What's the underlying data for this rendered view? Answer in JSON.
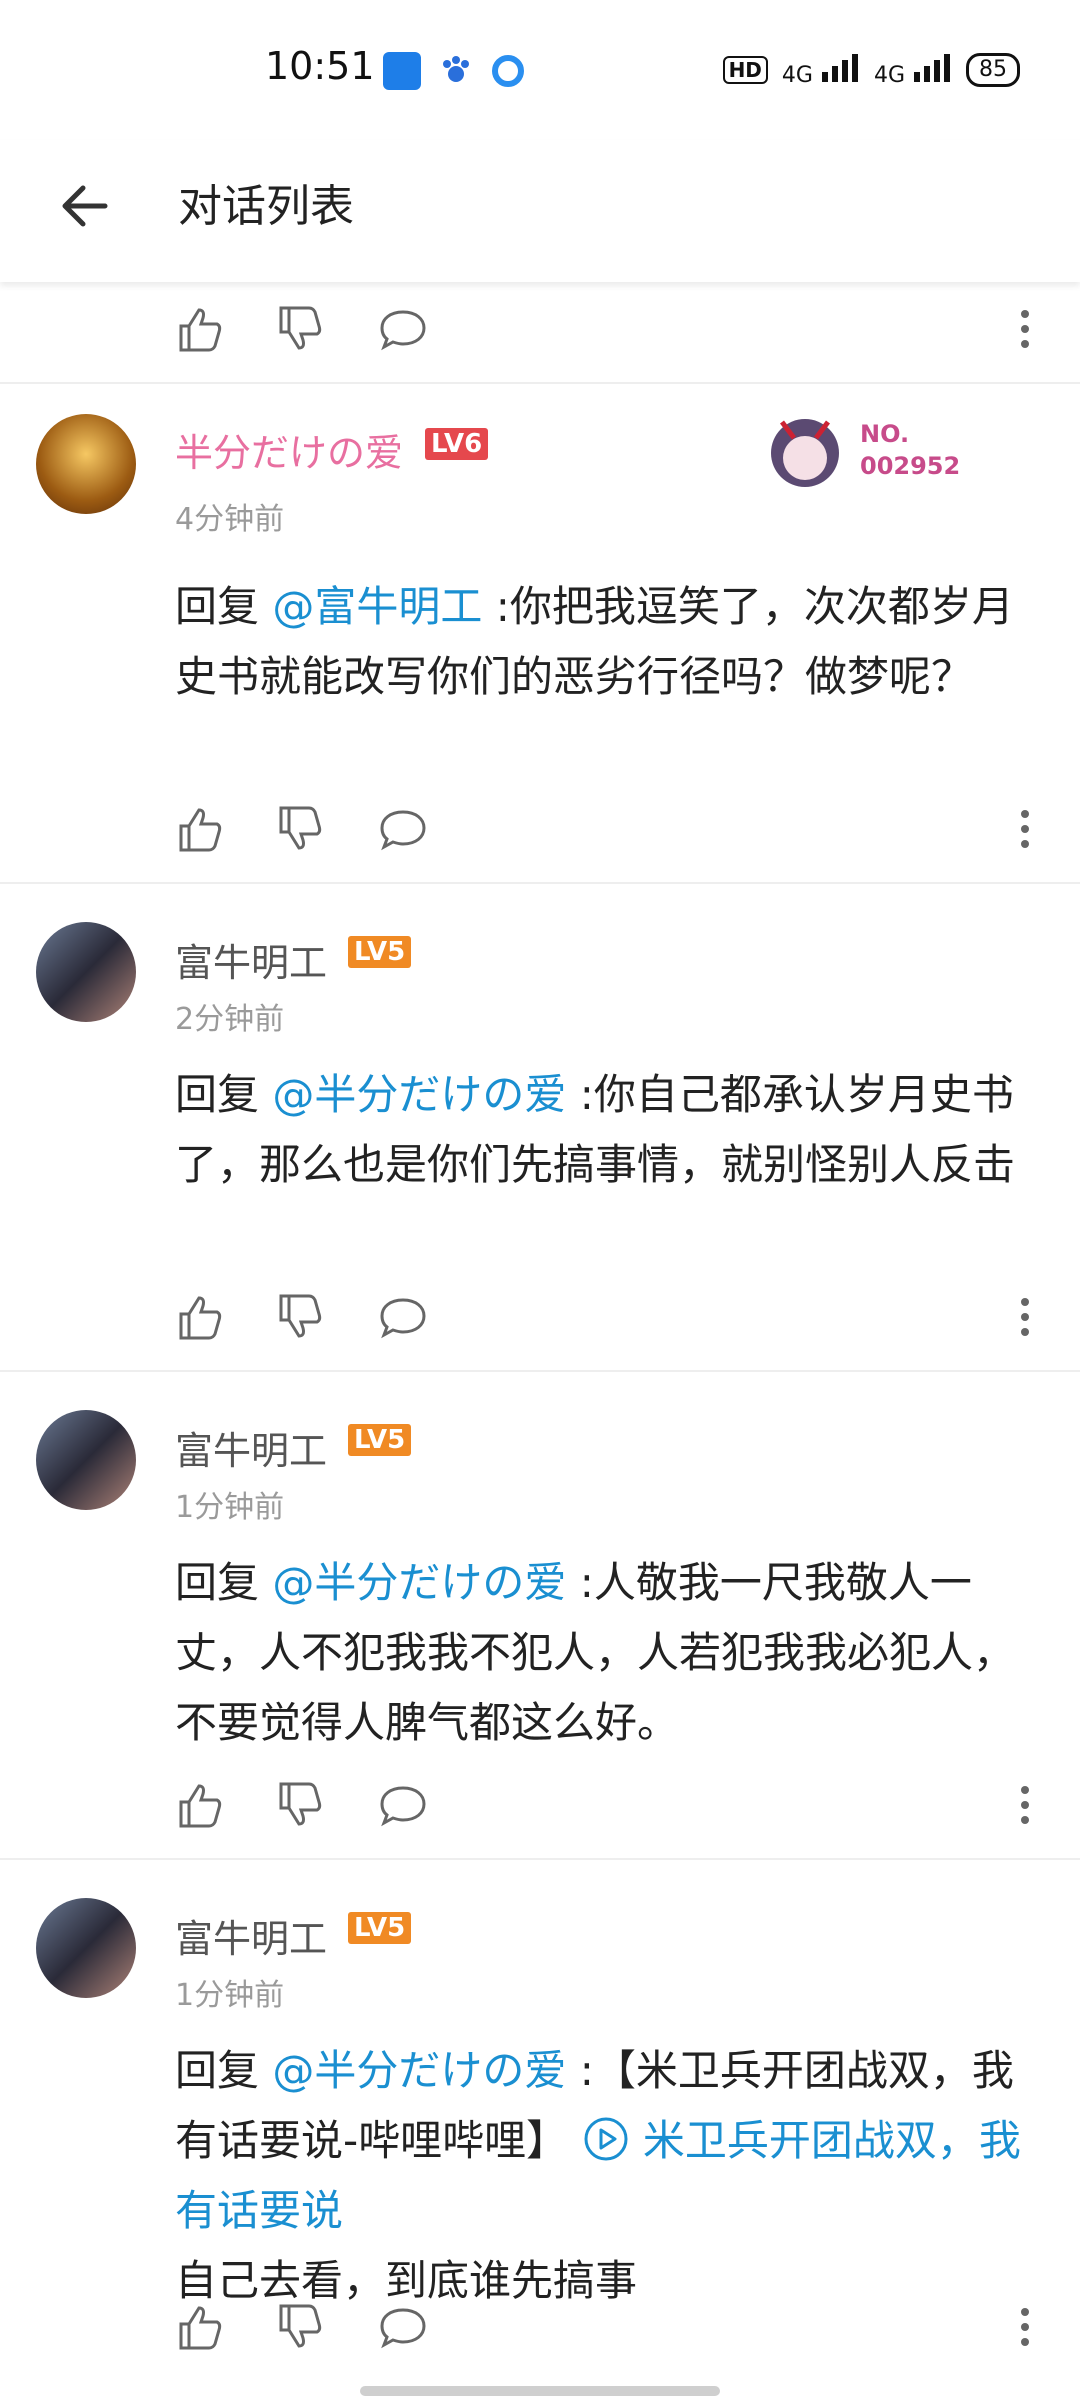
{
  "status_bar": {
    "time": "10:51",
    "hd": "HD",
    "net1": "4G",
    "net2": "4G",
    "battery": "85"
  },
  "header": {
    "title": "对话列表"
  },
  "comments": [
    {
      "username": "半分だけの爱",
      "level": "LV6",
      "time": "4分钟前",
      "reply_prefix": "回复 ",
      "mention": "@富牛明工",
      "text": " :你把我逗笑了，次次都岁月史书就能改写你们的恶劣行径吗？做梦呢？",
      "medal_no": "NO.",
      "medal_num": "002952",
      "name_color": "#e86fa0"
    },
    {
      "username": "富牛明工",
      "level": "LV5",
      "time": "2分钟前",
      "reply_prefix": "回复 ",
      "mention": "@半分だけの爱",
      "text": " :你自己都承认岁月史书了，那么也是你们先搞事情，就别怪别人反击"
    },
    {
      "username": "富牛明工",
      "level": "LV5",
      "time": "1分钟前",
      "reply_prefix": "回复 ",
      "mention": "@半分だけの爱",
      "text": " :人敬我一尺我敬人一丈，人不犯我我不犯人，人若犯我我必犯人，不要觉得人脾气都这么好。"
    },
    {
      "username": "富牛明工",
      "level": "LV5",
      "time": "1分钟前",
      "reply_prefix": "回复 ",
      "mention": "@半分だけの爱",
      "text": " :【米卫兵开团战双，我有话要说-哔哩哔哩】 ",
      "link_text": "米卫兵开团战双，我有话要说",
      "text2": "自己去看，到底谁先搞事"
    }
  ],
  "colors": {
    "mention": "#1a8fd1",
    "lv6": "#e5484d",
    "lv5": "#f08a24"
  }
}
